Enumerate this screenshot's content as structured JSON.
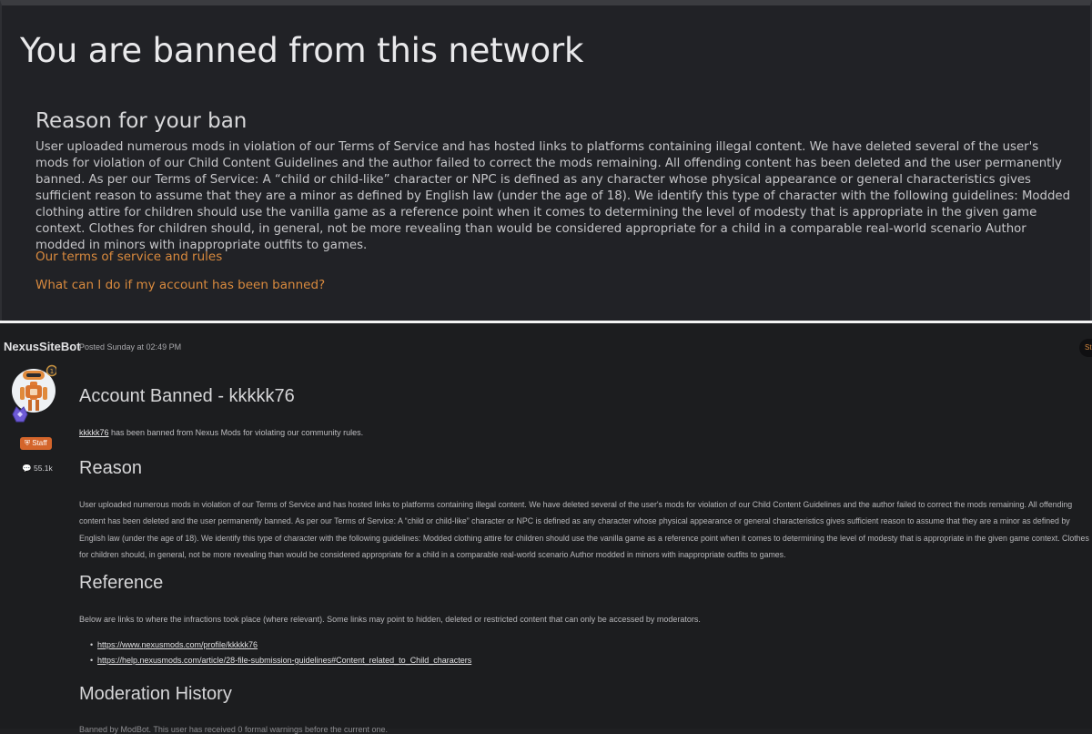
{
  "ban_notice": {
    "title": "You are banned from this network",
    "reason_heading": "Reason for your ban",
    "reason_text": "User uploaded numerous mods in violation of our Terms of Service and has hosted links to platforms containing illegal content. We have deleted several of the user's mods for violation of our Child Content Guidelines and the author failed to correct the mods remaining. All offending content has been deleted and the user permanently banned. As per our Terms of Service: A “child or child-like” character or NPC is defined as any character whose physical appearance or general characteristics gives sufficient reason to assume that they are a minor as defined by English law (under the age of 18). We identify this type of character with the following guidelines: Modded clothing attire for children should use the vanilla game as a reference point when it comes to determining the level of modesty that is appropriate in the given game context. Clothes for children should, in general, not be more revealing than would be considered appropriate for a child in a comparable real-world scenario Author modded in minors with inappropriate outfits to games.",
    "link_terms": "Our terms of service and rules",
    "link_appeal": "What can I do if my account has been banned?"
  },
  "post": {
    "author": "NexusSiteBot",
    "posted": "Posted Sunday at 02:49 PM",
    "corner_badge": "St",
    "staff_label": "Staff",
    "post_count": "55.1k",
    "title": "Account Banned - kkkkk76",
    "intro_user": "kkkkk76",
    "intro_rest": " has been banned from Nexus Mods for violating our community rules.",
    "reason_heading": "Reason",
    "reason_text": "User uploaded numerous mods in violation of our Terms of Service and has hosted links to platforms containing illegal content. We have deleted several of the user's mods for violation of our Child Content Guidelines and the author failed to correct the mods remaining. All offending content has been deleted and the user permanently banned. As per our Terms of Service: A “child or child-like” character or NPC is defined as any character whose physical appearance or general characteristics gives sufficient reason to assume that they are a minor as defined by English law (under the age of 18). We identify this type of character with the following guidelines: Modded clothing attire for children should use the vanilla game as a reference point when it comes to determining the level of modesty that is appropriate in the given game context. Clothes for children should, in general, not be more revealing than would be considered appropriate for a child in a comparable real-world scenario Author modded in minors with inappropriate outfits to games.",
    "reference_heading": "Reference",
    "reference_intro": "Below are links to where the infractions took place (where relevant). Some links may point to hidden, deleted or restricted content that can only be accessed by moderators.",
    "reference_links": [
      "https://www.nexusmods.com/profile/kkkkk76",
      "https://help.nexusmods.com/article/28-file-submission-guidelines#Content_related_to_Child_characters"
    ],
    "moderation_heading": "Moderation History",
    "clipped_line": "Banned by ModBot. This user has received 0 formal warnings before the current one."
  },
  "icons": {
    "avatar": "robot-avatar-icon",
    "staff": "shield-icon",
    "posts": "speech-bubble-icon"
  },
  "colors": {
    "link_orange": "#d98a3e",
    "staff_badge": "#d4652b",
    "panel_bg": "#212226",
    "post_bg": "#1c1d1f"
  }
}
